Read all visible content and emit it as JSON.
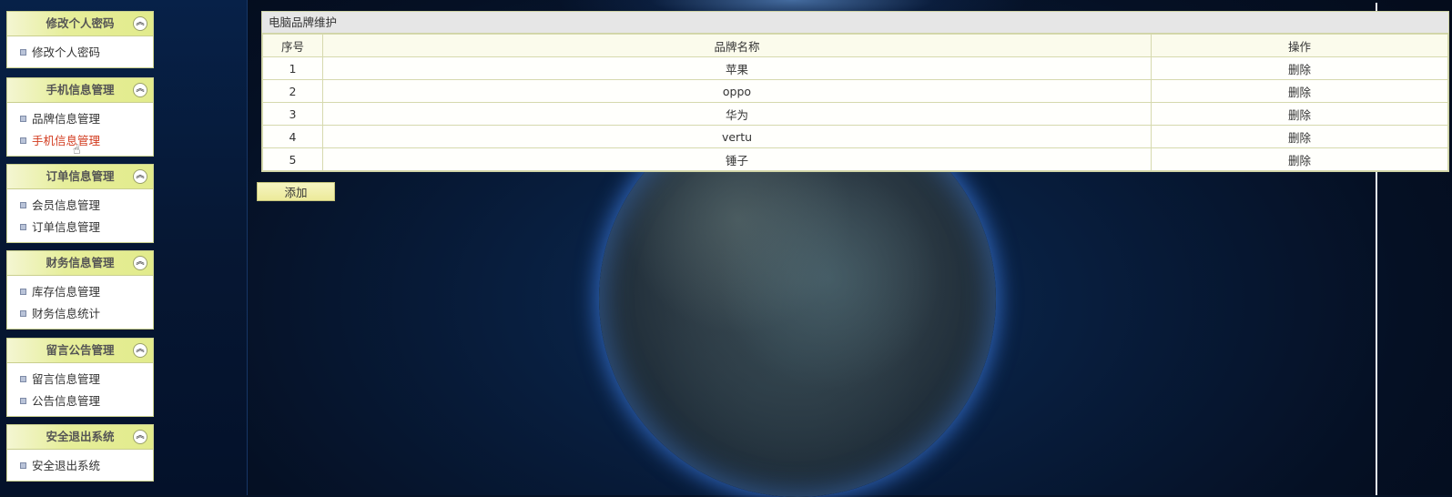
{
  "sidebar": {
    "panels": [
      {
        "title": "修改个人密码",
        "items": [
          {
            "label": "修改个人密码"
          }
        ]
      },
      {
        "title": "手机信息管理",
        "items": [
          {
            "label": "品牌信息管理"
          },
          {
            "label": "手机信息管理"
          }
        ]
      },
      {
        "title": "订单信息管理",
        "items": [
          {
            "label": "会员信息管理"
          },
          {
            "label": "订单信息管理"
          }
        ]
      },
      {
        "title": "财务信息管理",
        "items": [
          {
            "label": "库存信息管理"
          },
          {
            "label": "财务信息统计"
          }
        ]
      },
      {
        "title": "留言公告管理",
        "items": [
          {
            "label": "留言信息管理"
          },
          {
            "label": "公告信息管理"
          }
        ]
      },
      {
        "title": "安全退出系统",
        "items": [
          {
            "label": "安全退出系统"
          }
        ]
      }
    ],
    "active_item": "手机信息管理",
    "collapse_icon": "double-chevron-up-icon"
  },
  "main": {
    "title": "电脑品牌维护",
    "columns": [
      "序号",
      "品牌名称",
      "操作"
    ],
    "rows": [
      {
        "no": "1",
        "name": "苹果",
        "action": "删除"
      },
      {
        "no": "2",
        "name": "oppo",
        "action": "删除"
      },
      {
        "no": "3",
        "name": "华为",
        "action": "删除"
      },
      {
        "no": "4",
        "name": "vertu",
        "action": "删除"
      },
      {
        "no": "5",
        "name": "锤子",
        "action": "删除"
      }
    ],
    "add_button_label": "添加"
  },
  "colors": {
    "panel_header": "#e2eb8c",
    "active_link": "#d23a1e",
    "table_border": "#d6d9ae",
    "background": "#061226"
  }
}
